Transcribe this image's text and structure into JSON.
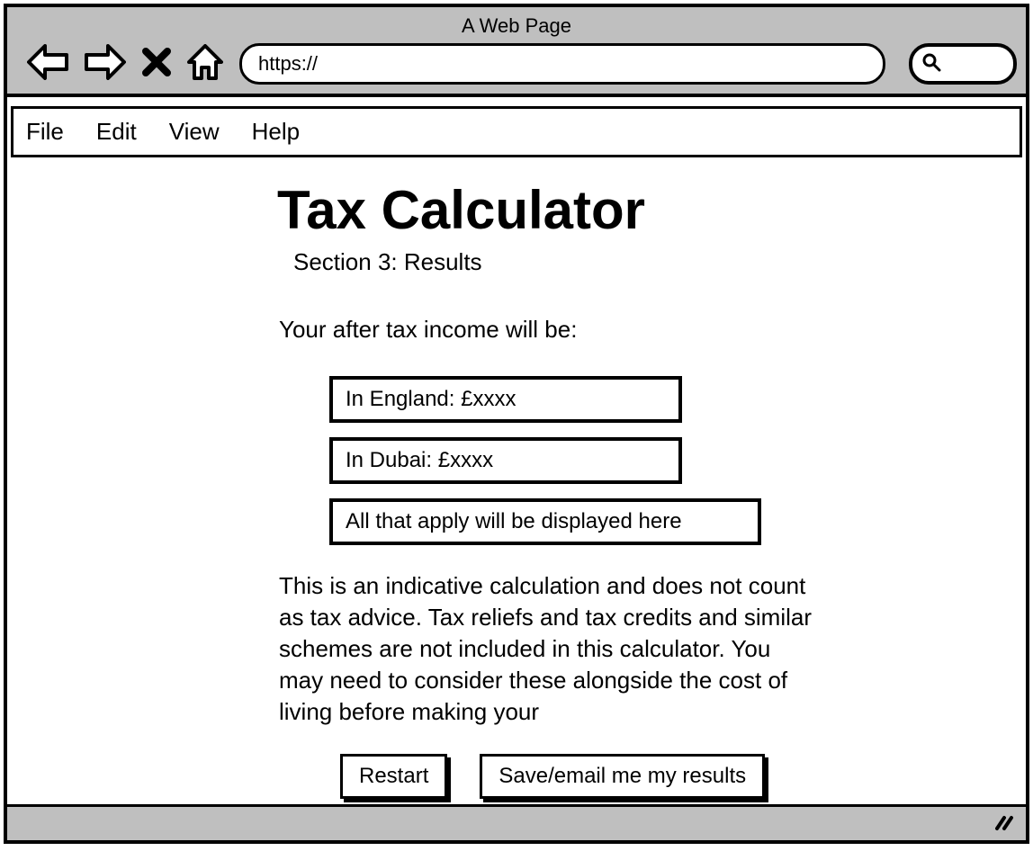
{
  "browser": {
    "title": "A Web Page",
    "url": "https://",
    "icons": {
      "back": "back-arrow-icon",
      "forward": "forward-arrow-icon",
      "stop": "stop-x-icon",
      "home": "home-icon",
      "search": "search-icon"
    }
  },
  "menu": {
    "items": [
      "File",
      "Edit",
      "View",
      "Help"
    ]
  },
  "page": {
    "title": "Tax Calculator",
    "section": "Section 3: Results",
    "intro": "Your after tax income will be:",
    "results": [
      "In England: £xxxx",
      "In Dubai: £xxxx",
      "All that apply will be displayed here"
    ],
    "disclaimer": "This is an indicative calculation and does not count as tax advice. Tax reliefs and tax credits and similar schemes are not included in this calculator. You may need to consider these alongside the cost of living before making your",
    "buttons": {
      "restart": "Restart",
      "save": "Save/email me my results"
    }
  },
  "footer": {
    "resize_icon": "resize-handle-icon"
  }
}
